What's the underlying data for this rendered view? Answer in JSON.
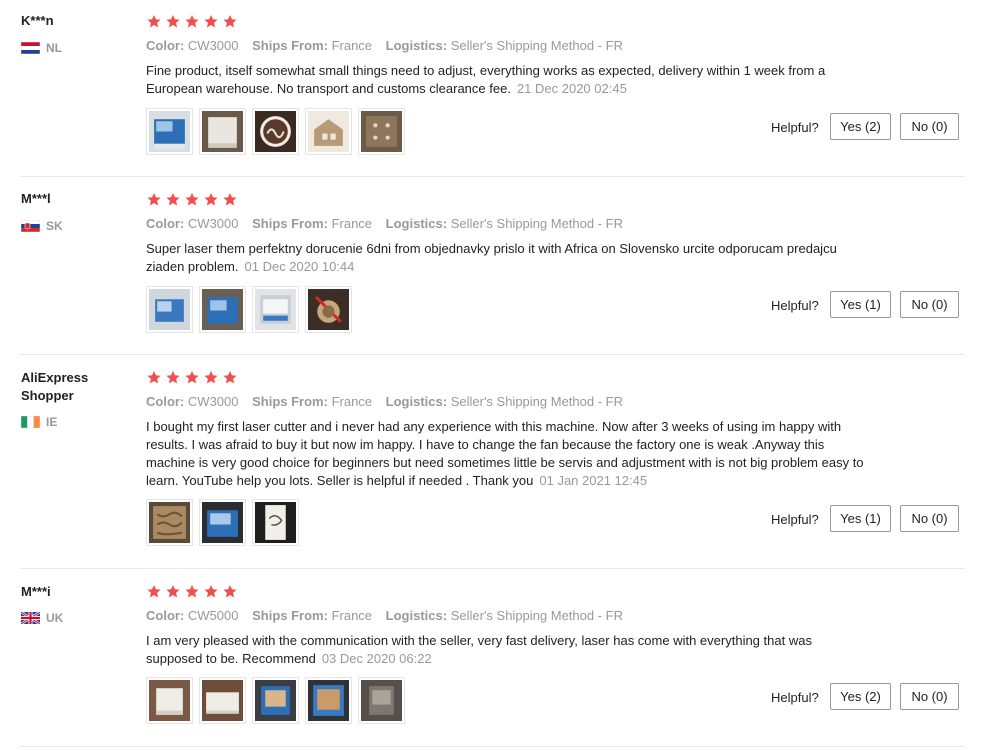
{
  "labels": {
    "color": "Color:",
    "ships_from": "Ships From:",
    "logistics": "Logistics:",
    "helpful": "Helpful?"
  },
  "colors": {
    "star": "#f24e4e",
    "muted": "#999999",
    "text": "#222222"
  },
  "reviews": [
    {
      "user": "K***n",
      "country": "NL",
      "flag": "flag-nl",
      "rating": 5,
      "color": "CW3000",
      "ships_from": "France",
      "logistics": "Seller's Shipping Method - FR",
      "text": "Fine product, itself somewhat small things need to adjust, everything works as expected, delivery within 1 week from a European warehouse. No transport and customs clearance fee.",
      "date": "21 Dec 2020 02:45",
      "photos": [
        "laser-machine-photo",
        "laser-box-photo",
        "engraved-name-disc-photo",
        "engraved-wood-house-photo",
        "engraved-wood-panel-photo"
      ],
      "yes": "Yes (2)",
      "no": "No (0)"
    },
    {
      "user": "M***l",
      "country": "SK",
      "flag": "flag-sk",
      "rating": 5,
      "color": "CW3000",
      "ships_from": "France",
      "logistics": "Seller's Shipping Method - FR",
      "text": "Super laser them perfektny dorucenie 6dni from objednavky prislo it with Africa on Slovensko urcite odporucam predajcu ziaden problem.",
      "date": "01 Dec 2020 10:44",
      "photos": [
        "laser-machine-photo",
        "laser-machine-photo",
        "laser-machine-open-photo",
        "engraved-ornament-photo"
      ],
      "yes": "Yes (1)",
      "no": "No (0)"
    },
    {
      "user": "AliExpress Shopper",
      "country": "IE",
      "flag": "flag-ie",
      "rating": 5,
      "color": "CW3000",
      "ships_from": "France",
      "logistics": "Seller's Shipping Method - FR",
      "text": "I bought my first laser cutter and i never had any experience with this machine. Now after 3 weeks of using im happy with results. I was afraid to buy it but now im happy. I have to change the fan because the factory one is weak .Anyway this machine is very good choice for beginners but need sometimes little be servis and adjustment with is not big problem easy to learn. YouTube help you lots. Seller is helpful if needed . Thank you",
      "date": "01 Jan 2021 12:45",
      "photos": [
        "engraved-wood-photo",
        "laser-machine-photo",
        "engraved-card-photo"
      ],
      "yes": "Yes (1)",
      "no": "No (0)"
    },
    {
      "user": "M***i",
      "country": "UK",
      "flag": "flag-uk",
      "rating": 5,
      "color": "CW5000",
      "ships_from": "France",
      "logistics": "Seller's Shipping Method - FR",
      "text": "I am very pleased with the communication with the seller, very fast delivery, laser has come with everything that was supposed to be. Recommend",
      "date": "03 Dec 2020 06:22",
      "photos": [
        "laser-box-photo",
        "laser-box-photo",
        "laser-machine-photo",
        "laser-machine-photo",
        "laser-machine-photo"
      ],
      "yes": "Yes (2)",
      "no": "No (0)"
    }
  ]
}
